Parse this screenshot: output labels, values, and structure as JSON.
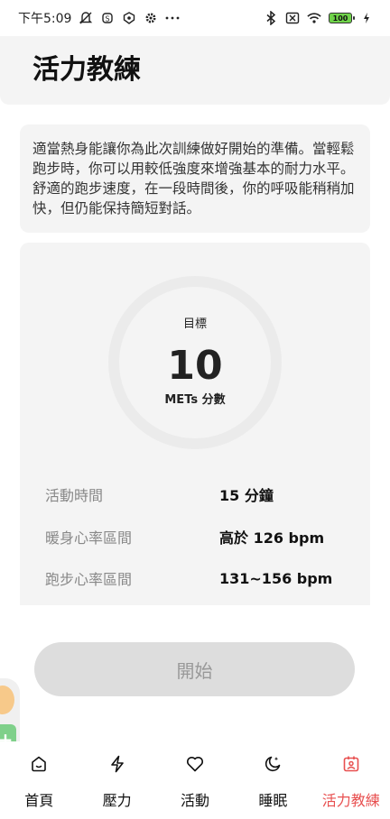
{
  "status_bar": {
    "time": "下午5:09",
    "battery_level": "100"
  },
  "header": {
    "title": "活力教練"
  },
  "description": {
    "text": "適當熱身能讓你為此次訓練做好開始的準備。當輕鬆跑步時，你可以用較低強度來增強基本的耐力水平。舒適的跑步速度，在一段時間後，你的呼吸能稍稍加快，但仍能保持簡短對話。"
  },
  "target": {
    "label": "目標",
    "value": "10",
    "unit": "METs 分數"
  },
  "info_rows": [
    {
      "label": "活動時間",
      "value": "15 分鐘"
    },
    {
      "label": "暖身心率區間",
      "value": "高於 126 bpm"
    },
    {
      "label": "跑步心率區間",
      "value": "131~156 bpm"
    }
  ],
  "start_button": {
    "label": "開始"
  },
  "nav": {
    "items": [
      {
        "label": "首頁",
        "icon": "home-icon"
      },
      {
        "label": "壓力",
        "icon": "lightning-icon"
      },
      {
        "label": "活動",
        "icon": "heart-icon"
      },
      {
        "label": "睡眠",
        "icon": "moon-icon"
      },
      {
        "label": "活力教練",
        "icon": "coach-icon",
        "active": true
      }
    ]
  },
  "colors": {
    "accent": "#e85050",
    "card_bg": "#f4f4f4",
    "button_bg": "#dddddd"
  }
}
